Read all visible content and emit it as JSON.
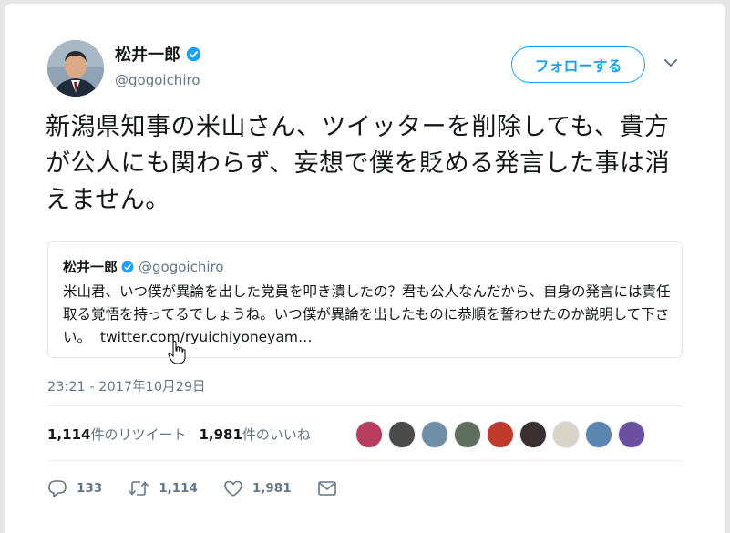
{
  "author": {
    "name": "松井一郎",
    "handle": "@gogoichiro"
  },
  "follow_label": "フォローする",
  "tweet_text": "新潟県知事の米山さん、ツイッターを削除しても、貴方が公人にも関わらず、妄想で僕を貶める発言した事は消えません。",
  "quoted": {
    "name": "松井一郎",
    "handle": "@gogoichiro",
    "text": "米山君、いつ僕が異論を出した党員を叩き潰したの？君も公人なんだから、自身の発言には責任取る覚悟を持ってるでしょうね。いつ僕が異論を出したものに恭順を誓わせたのか説明して下さい。",
    "link": "twitter.com/ryuichiyoneyam…"
  },
  "timestamp": "23:21 - 2017年10月29日",
  "stats": {
    "retweets_count": "1,114",
    "retweets_label": "件のリツイート",
    "likes_count": "1,981",
    "likes_label": "件のいいね"
  },
  "likers": [
    "#b83d5c",
    "#4a4a4a",
    "#6f8fa8",
    "#5f6f5e",
    "#c03a2b",
    "#3a3030",
    "#d9d4c8",
    "#5b86b0",
    "#6b4fa0"
  ],
  "actions": {
    "reply_count": "133",
    "retweet_count": "1,114",
    "like_count": "1,981"
  },
  "colors": {
    "accent": "#1da1f2",
    "muted": "#657786",
    "text": "#14171a"
  }
}
